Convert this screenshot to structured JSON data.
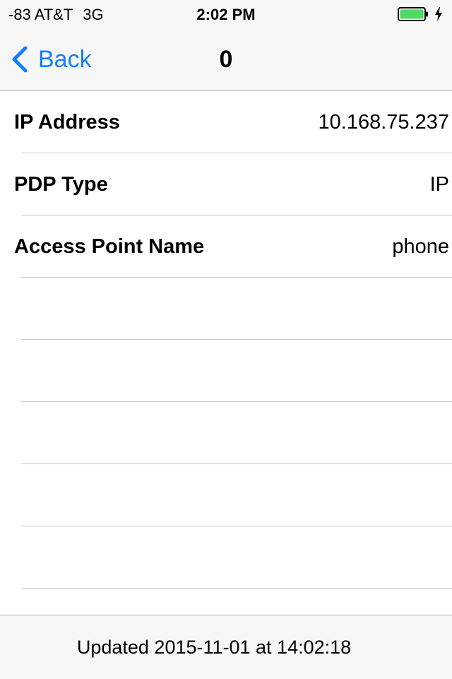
{
  "status_bar": {
    "signal": "-83 AT&T",
    "network": "3G",
    "time": "2:02 PM",
    "battery_color": "#4cd964"
  },
  "nav": {
    "back_label": "Back",
    "title": "0",
    "tint_color": "#157efb"
  },
  "rows": [
    {
      "label": "IP Address",
      "value": "10.168.75.237"
    },
    {
      "label": "PDP Type",
      "value": "IP"
    },
    {
      "label": "Access Point Name",
      "value": "phone"
    },
    {
      "label": "",
      "value": ""
    },
    {
      "label": "",
      "value": ""
    },
    {
      "label": "",
      "value": ""
    },
    {
      "label": "",
      "value": ""
    },
    {
      "label": "",
      "value": ""
    }
  ],
  "footer": {
    "updated_text": "Updated 2015-11-01 at 14:02:18"
  }
}
